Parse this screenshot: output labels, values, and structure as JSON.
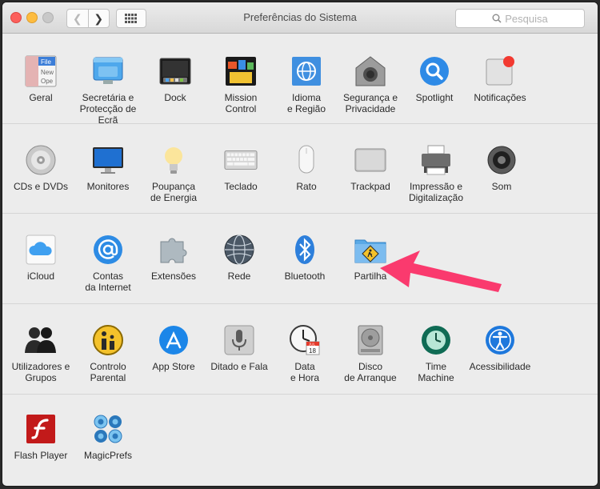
{
  "window": {
    "title": "Preferências do Sistema",
    "search_placeholder": "Pesquisa"
  },
  "sections": [
    {
      "items": [
        {
          "label": "Geral",
          "icon": "general-icon"
        },
        {
          "label": "Secretária e\nProtecção de Ecrã",
          "icon": "desktop-screensaver-icon"
        },
        {
          "label": "Dock",
          "icon": "dock-icon"
        },
        {
          "label": "Mission\nControl",
          "icon": "mission-control-icon"
        },
        {
          "label": "Idioma\ne Região",
          "icon": "language-region-icon"
        },
        {
          "label": "Segurança e\nPrivacidade",
          "icon": "security-privacy-icon"
        },
        {
          "label": "Spotlight",
          "icon": "spotlight-icon"
        },
        {
          "label": "Notificações",
          "icon": "notifications-icon"
        }
      ]
    },
    {
      "items": [
        {
          "label": "CDs e DVDs",
          "icon": "cds-dvds-icon"
        },
        {
          "label": "Monitores",
          "icon": "displays-icon"
        },
        {
          "label": "Poupança\nde Energia",
          "icon": "energy-saver-icon"
        },
        {
          "label": "Teclado",
          "icon": "keyboard-icon"
        },
        {
          "label": "Rato",
          "icon": "mouse-icon"
        },
        {
          "label": "Trackpad",
          "icon": "trackpad-icon"
        },
        {
          "label": "Impressão e\nDigitalização",
          "icon": "printers-scanners-icon"
        },
        {
          "label": "Som",
          "icon": "sound-icon"
        }
      ]
    },
    {
      "items": [
        {
          "label": "iCloud",
          "icon": "icloud-icon"
        },
        {
          "label": "Contas\nda Internet",
          "icon": "internet-accounts-icon"
        },
        {
          "label": "Extensões",
          "icon": "extensions-icon"
        },
        {
          "label": "Rede",
          "icon": "network-icon"
        },
        {
          "label": "Bluetooth",
          "icon": "bluetooth-icon"
        },
        {
          "label": "Partilha",
          "icon": "sharing-icon"
        }
      ]
    },
    {
      "items": [
        {
          "label": "Utilizadores e\nGrupos",
          "icon": "users-groups-icon"
        },
        {
          "label": "Controlo\nParental",
          "icon": "parental-controls-icon"
        },
        {
          "label": "App Store",
          "icon": "app-store-icon"
        },
        {
          "label": "Ditado e Fala",
          "icon": "dictation-speech-icon"
        },
        {
          "label": "Data\ne Hora",
          "icon": "date-time-icon"
        },
        {
          "label": "Disco\nde Arranque",
          "icon": "startup-disk-icon"
        },
        {
          "label": "Time\nMachine",
          "icon": "time-machine-icon"
        },
        {
          "label": "Acessibilidade",
          "icon": "accessibility-icon"
        }
      ]
    },
    {
      "items": [
        {
          "label": "Flash Player",
          "icon": "flash-player-icon"
        },
        {
          "label": "MagicPrefs",
          "icon": "magicprefs-icon"
        }
      ]
    }
  ],
  "icon_text": {
    "general_file": "File",
    "general_new": "New",
    "general_open": "Ope",
    "calendar_month": "JUL",
    "calendar_day": "18"
  },
  "colors": {
    "annotation_arrow": "#fa3a6e",
    "accent_blue": "#1e88e5"
  }
}
